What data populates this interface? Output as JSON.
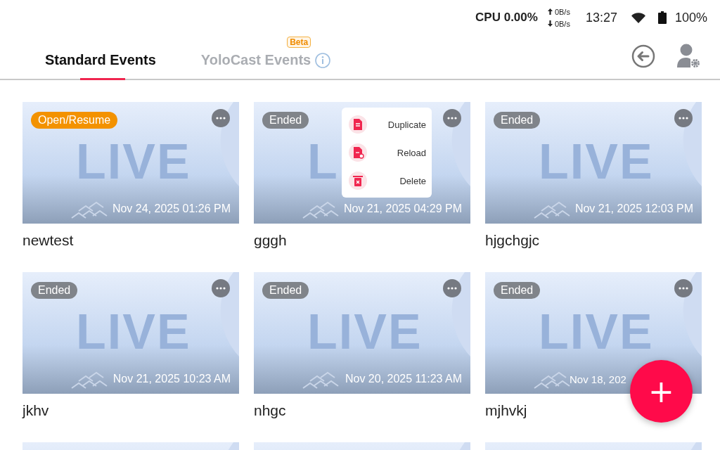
{
  "status_bar": {
    "cpu": "CPU 0.00%",
    "upload": "0B/s",
    "download": "0B/s",
    "time": "13:27",
    "battery": "100%"
  },
  "tabs": [
    {
      "label": "Standard Events",
      "selected": true
    },
    {
      "label": "YoloCast Events",
      "selected": false,
      "badge": "Beta"
    }
  ],
  "events": [
    {
      "name": "newtest",
      "status": "Open/Resume",
      "kind": "open",
      "date": "Nov 24, 2025 01:26 PM",
      "thumb_text": "LIVE"
    },
    {
      "name": "gggh",
      "status": "Ended",
      "kind": "ended",
      "date": "Nov 21, 2025 04:29 PM",
      "thumb_text": "L",
      "menu": [
        "Duplicate",
        "Reload",
        "Delete"
      ]
    },
    {
      "name": "hjgchgjc",
      "status": "Ended",
      "kind": "ended",
      "date": "Nov 21, 2025 12:03 PM",
      "thumb_text": "LIVE"
    },
    {
      "name": "jkhv",
      "status": "Ended",
      "kind": "ended",
      "date": "Nov 21, 2025 10:23 AM",
      "thumb_text": "LIVE"
    },
    {
      "name": "nhgc",
      "status": "Ended",
      "kind": "ended",
      "date": "Nov 20, 2025 11:23 AM",
      "thumb_text": "LIVE"
    },
    {
      "name": "mjhvkj",
      "status": "Ended",
      "kind": "ended",
      "date": "Nov 18, 202",
      "thumb_text": "LIVE"
    }
  ],
  "fab": "+"
}
